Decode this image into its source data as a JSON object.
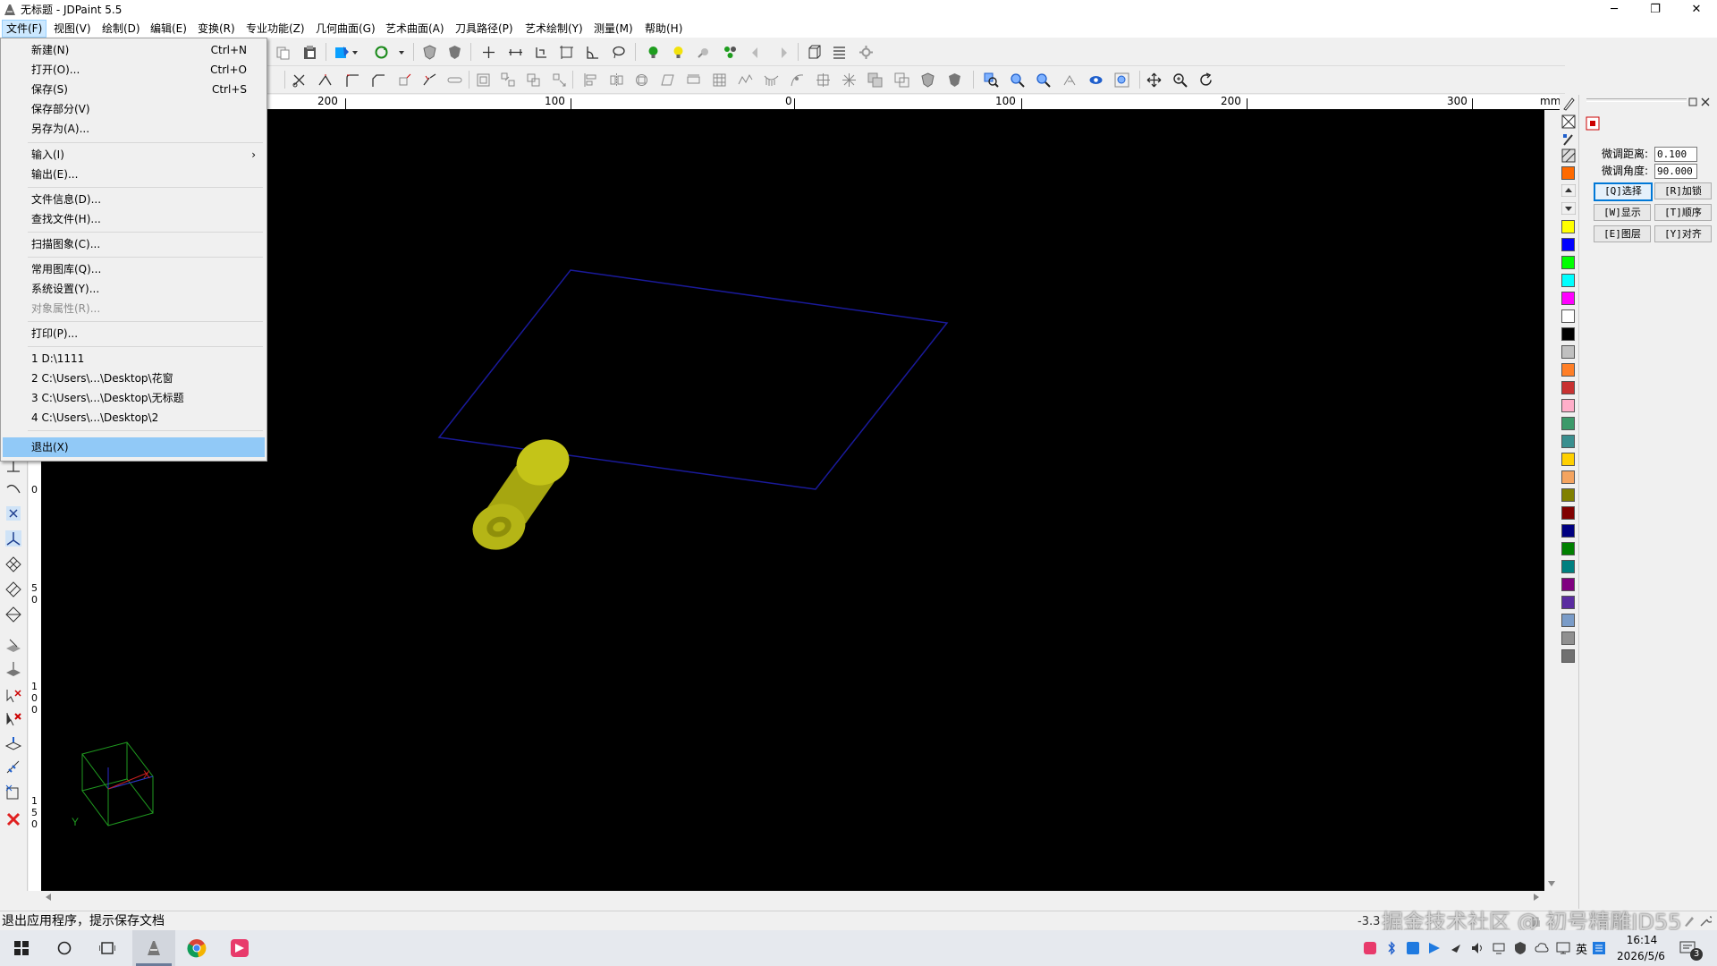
{
  "window": {
    "title": "无标题 - JDPaint 5.5",
    "minimize_glyph": "─",
    "maximize_glyph": "❐",
    "close_glyph": "✕"
  },
  "menubar": [
    {
      "label": "文件(F)",
      "active": true
    },
    {
      "label": "视图(V)"
    },
    {
      "label": "绘制(D)"
    },
    {
      "label": "编辑(E)"
    },
    {
      "label": "变换(R)"
    },
    {
      "label": "专业功能(Z)"
    },
    {
      "label": "几何曲面(G)"
    },
    {
      "label": "艺术曲面(A)"
    },
    {
      "label": "刀具路径(P)"
    },
    {
      "label": "艺术绘制(Y)"
    },
    {
      "label": "测量(M)"
    },
    {
      "label": "帮助(H)"
    }
  ],
  "file_menu": {
    "items": [
      {
        "label": "新建(N)",
        "shortcut": "Ctrl+N"
      },
      {
        "label": "打开(O)...",
        "shortcut": "Ctrl+O"
      },
      {
        "label": "保存(S)",
        "shortcut": "Ctrl+S"
      },
      {
        "label": "保存部分(V)",
        "shortcut": ""
      },
      {
        "label": "另存为(A)...",
        "shortcut": ""
      },
      {
        "label": "输入(I)",
        "shortcut": "",
        "submenu_glyph": "›"
      },
      {
        "label": "输出(E)...",
        "shortcut": ""
      },
      {
        "label": "文件信息(D)...",
        "shortcut": ""
      },
      {
        "label": "查找文件(H)...",
        "shortcut": ""
      },
      {
        "label": "扫描图象(C)...",
        "shortcut": ""
      },
      {
        "label": "常用图库(Q)...",
        "shortcut": ""
      },
      {
        "label": "系统设置(Y)...",
        "shortcut": ""
      },
      {
        "label": "对象属性(R)...",
        "shortcut": "",
        "disabled": true
      },
      {
        "label": "打印(P)...",
        "shortcut": ""
      },
      {
        "label": "1 D:\\1111",
        "shortcut": ""
      },
      {
        "label": "2 C:\\Users\\...\\Desktop\\花窗",
        "shortcut": ""
      },
      {
        "label": "3 C:\\Users\\...\\Desktop\\无标题",
        "shortcut": ""
      },
      {
        "label": "4 C:\\Users\\...\\Desktop\\2",
        "shortcut": ""
      },
      {
        "label": "退出(X)",
        "shortcut": "",
        "highlighted": true
      }
    ]
  },
  "ruler": {
    "labels": [
      "200",
      "100",
      "0",
      "100",
      "200",
      "300"
    ],
    "unit": "mm"
  },
  "vertical_ruler": {
    "digits": [
      "0",
      "5",
      "0",
      "1",
      "0",
      "0",
      "1",
      "5",
      "0"
    ]
  },
  "palette_colors": [
    "#ffff00",
    "#0000ff",
    "#00ff00",
    "#00ffff",
    "#ff00ff",
    "#ffffff",
    "#000000",
    "#c0c0c0",
    "#ff7f27",
    "#c83232",
    "#ffaec9",
    "#3c9a6a",
    "#3a8f8f",
    "#ffd000",
    "#f4a460",
    "#808000",
    "#800000",
    "#000080",
    "#008000",
    "#008080",
    "#800080",
    "#5a2ca0",
    "#7a9cc8",
    "#909090",
    "#707070"
  ],
  "top_swatch_color": "#ff6a00",
  "right_panel": {
    "fine_distance_label": "微调距离:",
    "fine_distance_value": "0.100",
    "fine_angle_label": "微调角度:",
    "fine_angle_value": "90.000",
    "buttons": [
      {
        "label": "[Q]选择",
        "selected": true
      },
      {
        "label": "[R]加锁"
      },
      {
        "label": "[W]显示"
      },
      {
        "label": "[T]顺序"
      },
      {
        "label": "[E]图层"
      },
      {
        "label": "[Y]对齐"
      }
    ]
  },
  "canvas": {
    "background": "#000000",
    "plane_color": "#1a1a9a",
    "cylinder_color": "#b5b516",
    "axis_labels": {
      "x": "X",
      "y": "Y"
    }
  },
  "statusbar": {
    "text": "退出应用程序，提示保存文档",
    "coords": "-3.3"
  },
  "taskbar": {
    "lang": "英",
    "time": "16:14",
    "date": "2026/5/6",
    "notification_count": "3"
  },
  "watermark": "掘金技术社区 @ 初号精雕JD55"
}
